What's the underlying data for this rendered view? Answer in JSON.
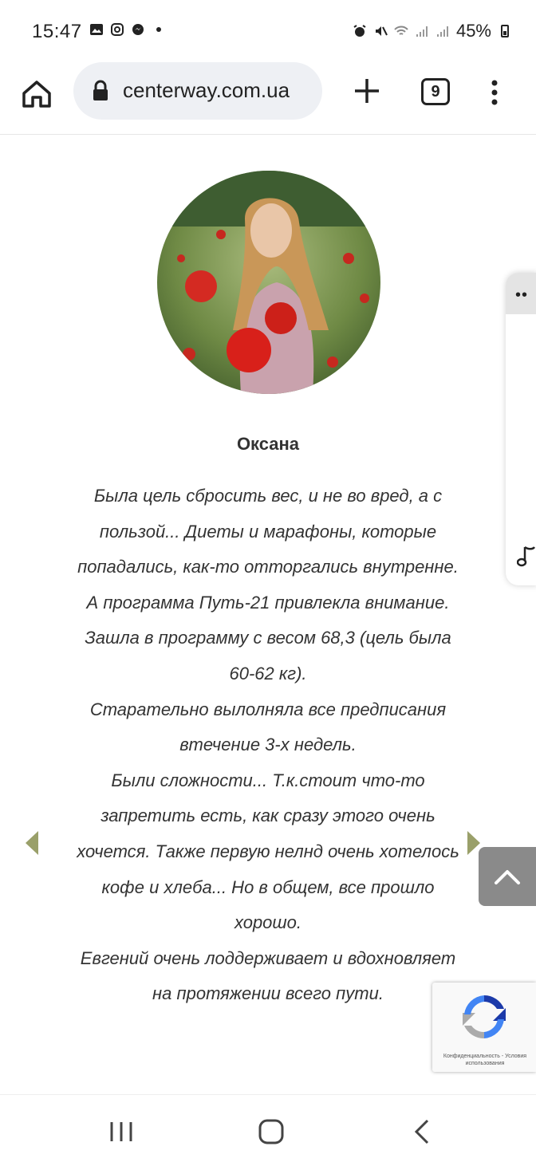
{
  "status_bar": {
    "time": "15:47",
    "left_icons": [
      "gallery-icon",
      "instagram-icon",
      "messenger-icon",
      "dot-icon"
    ],
    "right_icons": [
      "alarm-icon",
      "mute-icon",
      "wifi-icon",
      "signal-icon",
      "signal-icon"
    ],
    "battery": "45%"
  },
  "browser": {
    "url": "centerway.com.ua",
    "tab_count": "9"
  },
  "review": {
    "name": "Оксана",
    "paragraphs": [
      "Была цель сбросить вес, и не во вред, а с пользой... Диеты и марафоны, которые попадались, как-то отторгались внутренне. А программа Путь-21 привлекла внимание.",
      "Зашла в программу с весом 68,3 (цель была 60-62 кг).",
      "Старательно вылолняла все предписания втечение 3-х недель.",
      "Были сложности... Т.к.стоит что-то запретить есть, как сразу этого очень хочется. Также первую нелнд очень хотелось кофе и хлеба... Но в общем, все прошло хорошо.",
      "Евгений очень лоддерживает и вдохновляет на протяжении всего пути."
    ]
  },
  "recaptcha": {
    "text": "Конфиденциальность - Условия использования"
  },
  "colors": {
    "arrow": "#9aa06a",
    "scroll_btn": "#8a8a8a",
    "url_pill": "#eef0f4"
  }
}
